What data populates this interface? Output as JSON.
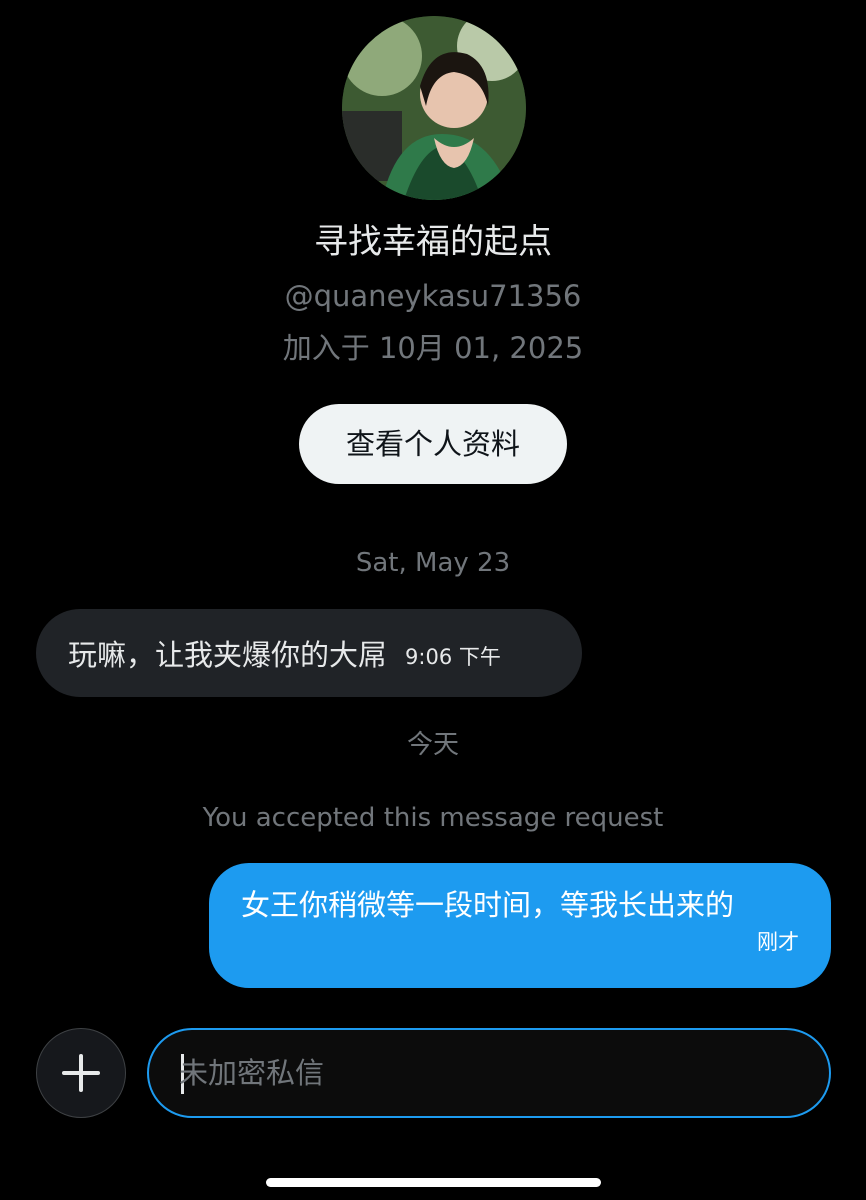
{
  "profile": {
    "display_name": "寻找幸福的起点",
    "handle": "@quaneykasu71356",
    "joined": "加入于 10月 01, 2025",
    "view_profile_label": "查看个人资料"
  },
  "conversation": {
    "date_separator": "Sat, May 23",
    "messages": [
      {
        "direction": "incoming",
        "text": "玩嘛，让我夹爆你的大屌",
        "time": "9:06 下午"
      },
      {
        "direction": "outgoing",
        "text": "女王你稍微等一段时间，等我长出来的",
        "time": "刚才"
      }
    ],
    "today_separator": "今天",
    "system_notice": "You accepted this message request"
  },
  "composer": {
    "placeholder": "未加密私信",
    "value": ""
  },
  "icons": {
    "add": "plus-icon"
  },
  "colors": {
    "background": "#000000",
    "accent": "#1d9bf0",
    "incoming_bubble": "#202327",
    "secondary_text": "#71767b",
    "primary_text": "#e7e9ea"
  }
}
